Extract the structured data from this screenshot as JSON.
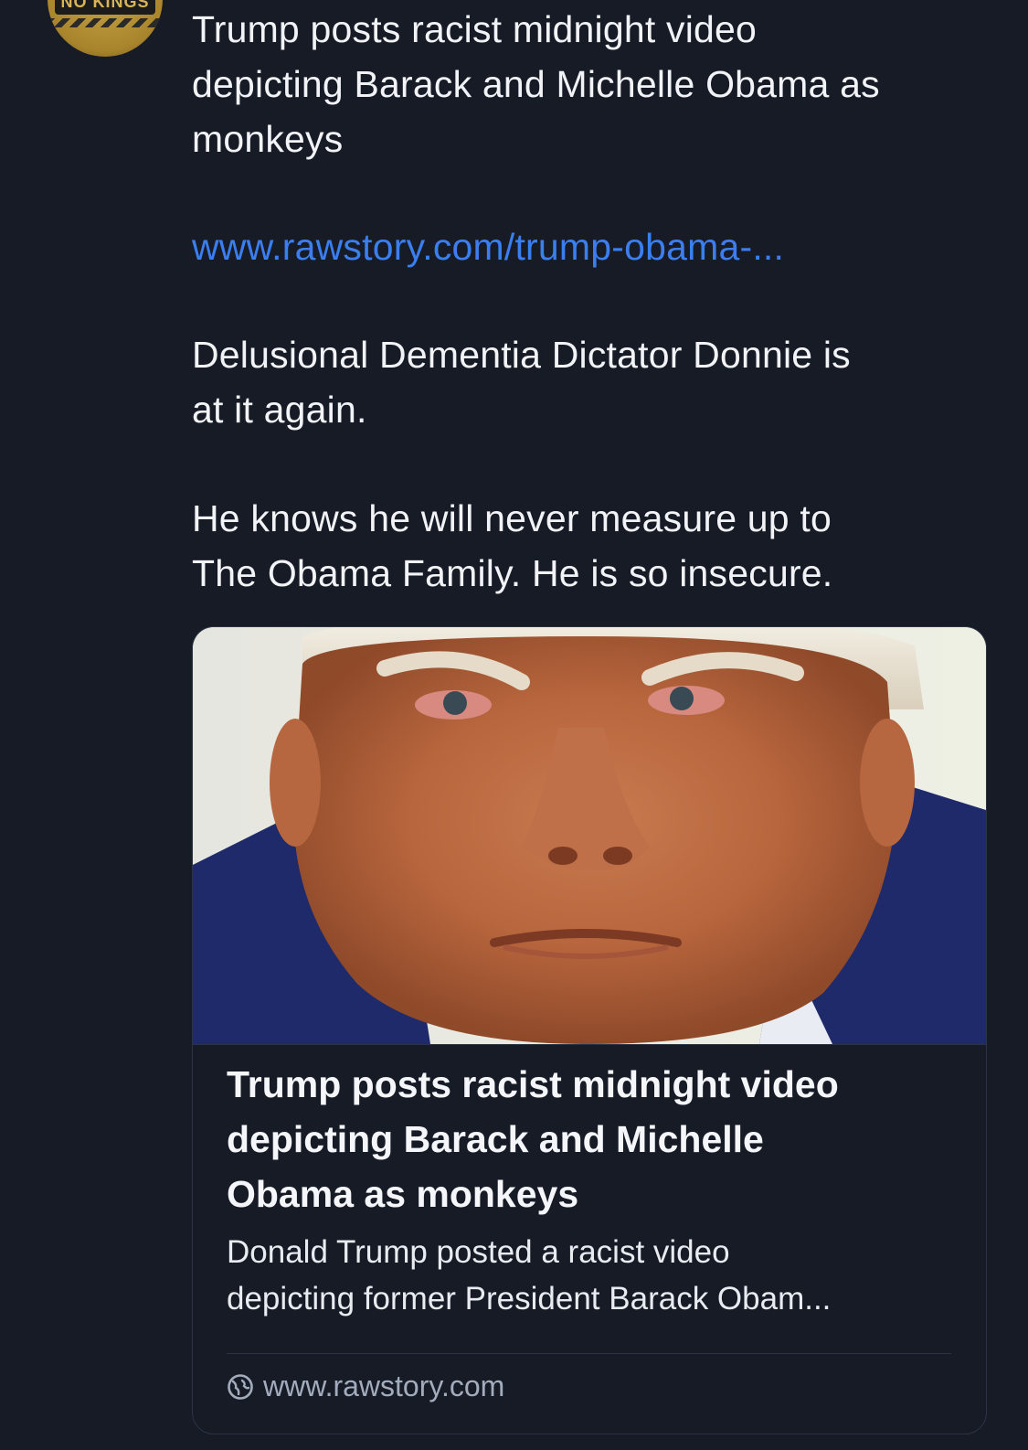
{
  "avatar": {
    "banner_text": "NO KINGS"
  },
  "post": {
    "title_lines": [
      "Trump posts racist midnight video",
      "depicting Barack and Michelle Obama as",
      "monkeys"
    ],
    "link_text": "www.rawstory.com/trump-obama-...",
    "paragraph_1_lines": [
      "Delusional Dementia Dictator Donnie is",
      "at it again."
    ],
    "paragraph_2_lines": [
      "He knows he will never measure up to",
      "The Obama Family.  He is so insecure."
    ]
  },
  "link_card": {
    "title_lines": [
      "Trump posts racist midnight video",
      "depicting Barack and Michelle",
      "Obama as monkeys"
    ],
    "description_lines": [
      "Donald Trump posted a racist video",
      "depicting former President Barack Obam..."
    ],
    "domain": "www.rawstory.com",
    "domain_icon": "globe-icon"
  },
  "colors": {
    "background": "#161b26",
    "link": "#3b7ef0",
    "text": "#f1f3f6",
    "muted": "#a3acbd",
    "border": "#2c3443"
  }
}
